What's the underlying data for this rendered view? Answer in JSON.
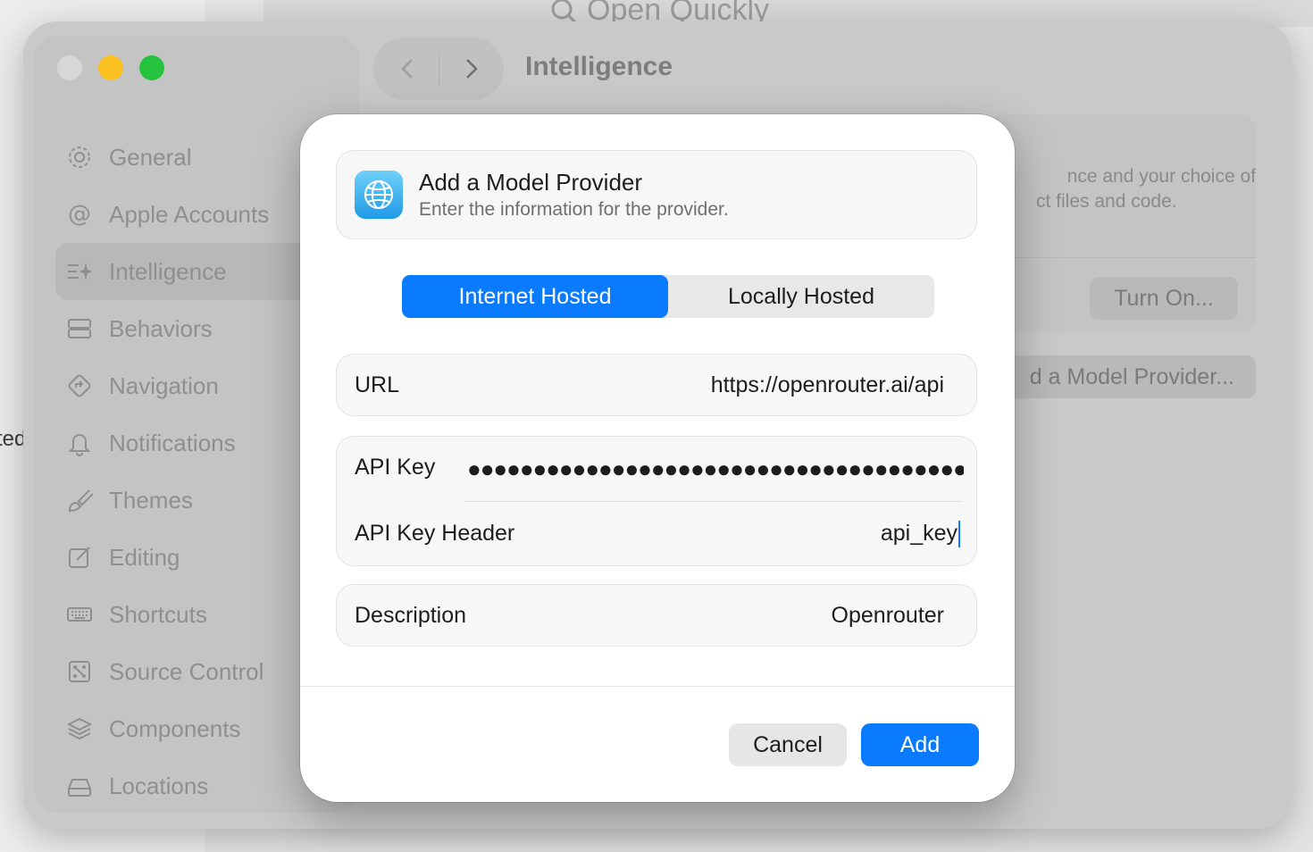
{
  "background": {
    "open_quickly_label": "Open Quickly",
    "left_cut_text": "ted"
  },
  "window": {
    "title": "Intelligence",
    "sidebar": {
      "items": [
        {
          "label": "General",
          "icon": "gear-icon"
        },
        {
          "label": "Apple Accounts",
          "icon": "at-sign-icon"
        },
        {
          "label": "Intelligence",
          "icon": "sparkle-list-icon",
          "selected": true
        },
        {
          "label": "Behaviors",
          "icon": "stack-rect-icon"
        },
        {
          "label": "Navigation",
          "icon": "diamond-arrow-icon"
        },
        {
          "label": "Notifications",
          "icon": "bell-icon"
        },
        {
          "label": "Themes",
          "icon": "paintbrush-icon"
        },
        {
          "label": "Editing",
          "icon": "edit-square-icon"
        },
        {
          "label": "Shortcuts",
          "icon": "keyboard-icon"
        },
        {
          "label": "Source Control",
          "icon": "source-control-icon"
        },
        {
          "label": "Components",
          "icon": "layers-icon"
        },
        {
          "label": "Locations",
          "icon": "drive-icon"
        }
      ]
    },
    "content": {
      "description_line1": "nce and your choice of",
      "description_line2": "ct files and code.",
      "turn_on_label": "Turn On...",
      "add_provider_label": "d a Model Provider..."
    }
  },
  "sheet": {
    "header": {
      "title": "Add a Model Provider",
      "subtitle": "Enter the information for the provider.",
      "icon": "globe-icon"
    },
    "hosting": {
      "options": [
        "Internet Hosted",
        "Locally Hosted"
      ],
      "selected": "Internet Hosted"
    },
    "fields": {
      "url": {
        "label": "URL",
        "value": "https://openrouter.ai/api"
      },
      "api_key": {
        "label": "API Key",
        "value": "●●●●●●●●●●●●●●●●●●●●●●●●●●●●●●●●●●●●●●●●●●●●●"
      },
      "api_key_header": {
        "label": "API Key Header",
        "value": "api_key"
      },
      "description": {
        "label": "Description",
        "value": "Openrouter"
      }
    },
    "buttons": {
      "cancel": "Cancel",
      "add": "Add"
    }
  },
  "colors": {
    "accent": "#0a7aff",
    "traffic_min": "#fbc120",
    "traffic_max": "#27c33f"
  }
}
